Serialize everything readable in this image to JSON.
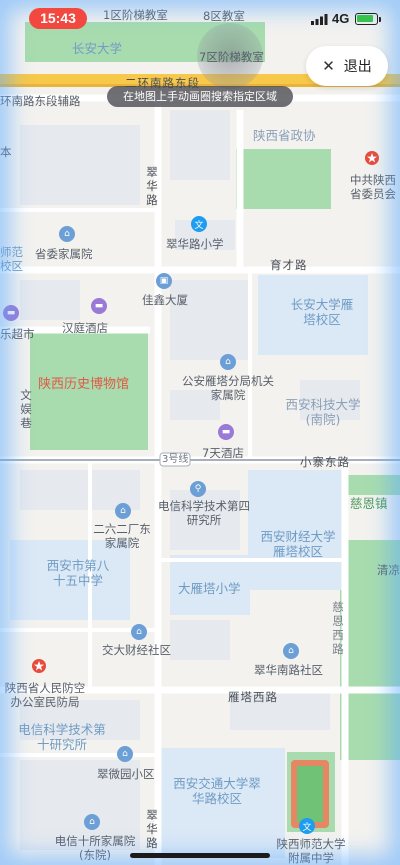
{
  "status_bar": {
    "time": "15:43",
    "network": "4G"
  },
  "exit_button": {
    "icon": "close-icon",
    "label": "退出"
  },
  "hint": "在地图上手动画圈搜索指定区域",
  "colors": {
    "water_glow": "#5aaaff",
    "green": "#a8dcae",
    "campus": "#dbe8f6",
    "road": "#ffffff",
    "arterial": "#f7c84a",
    "time_pill": "#f2483f"
  },
  "map": {
    "roads": {
      "south_second_ring": "二环南路东段",
      "ring_aux": "环南路东段辅路",
      "cuihua_north": "翠华路",
      "yucai": "育才路",
      "xiaozhai_east": "小寨东路",
      "line3": "3号线",
      "yanta_west": "雁塔西路",
      "ciensi": "慈恩西路",
      "cuihua_south": "翠华路"
    },
    "pois": {
      "class1": "1区阶梯教室",
      "class8": "8区教室",
      "chd": "长安大学",
      "class7": "7区阶梯教室",
      "cppcc": "陕西省政协",
      "ccp_shaanxi": "中共陕西省委员会",
      "cuihua_primary": "翠华路小学",
      "provincial_housing": "省委家属院",
      "jiaxin": "佳鑫大厦",
      "chd_yanta": "长安大学雁塔校区",
      "hanting": "汉庭酒店",
      "museum": "陕西历史博物馆",
      "police_housing": "公安雁塔分局机关家属院",
      "tech_south": "西安科技大学(南院)",
      "wenyuan": "文娱巷",
      "supermarket": "超市",
      "seven_days": "7天酒店",
      "telecom_4": "电信科学技术第四研究所",
      "factory_262": "二六二厂东家属院",
      "dayanta_group": "慈恩镇",
      "xcfe": "西安财经大学雁塔校区",
      "school85": "西安市第八十五中学",
      "dayan_primary": "大雁塔小学",
      "qingliang": "清凉",
      "jiaocai": "交大财经社区",
      "cuihua_south_comm": "翠华南路社区",
      "civil_defense": "陕西省人民防空办公室民防局",
      "telecom_10": "电信科学技术第十研究所",
      "cuiwei": "翠微园小区",
      "xjtu_cuihua": "西安交通大学翠华路校区",
      "telecom10_housing": "电信十所家属院(东院)",
      "snnu_high": "陕西师范大学附属中学",
      "fragment_shi": "市",
      "fragment_ben": "本",
      "fragment_shifan": "师范校区",
      "fragment_lee": "乐超市"
    }
  }
}
